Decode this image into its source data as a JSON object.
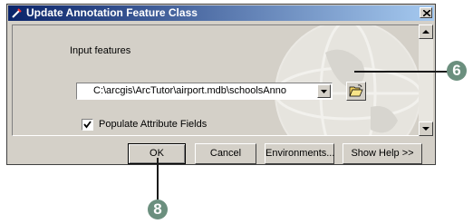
{
  "dialog": {
    "title": "Update Annotation Feature Class",
    "input_label": "Input features",
    "input_value": "C:\\arcgis\\ArcTutor\\airport.mdb\\schoolsAnno",
    "checkbox_label": "Populate Attribute Fields",
    "checkbox_checked": true,
    "buttons": {
      "ok": "OK",
      "cancel": "Cancel",
      "environments": "Environments...",
      "show_help": "Show Help >>"
    }
  },
  "callouts": {
    "browse_step": "6",
    "ok_step": "8"
  },
  "colors": {
    "title_start": "#0a246a",
    "title_end": "#a6caf0",
    "callout": "#6b8f7e",
    "dialog_bg": "#d4d0c8"
  }
}
